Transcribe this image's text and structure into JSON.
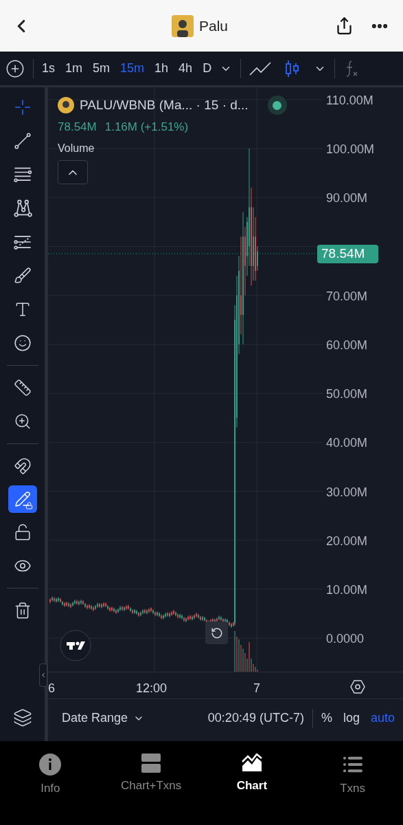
{
  "header": {
    "title": "Palu"
  },
  "toolbar": {
    "timeframes": [
      {
        "label": "1s",
        "selected": false
      },
      {
        "label": "1m",
        "selected": false
      },
      {
        "label": "5m",
        "selected": false
      },
      {
        "label": "15m",
        "selected": true
      },
      {
        "label": "1h",
        "selected": false
      },
      {
        "label": "4h",
        "selected": false
      },
      {
        "label": "D",
        "selected": false
      }
    ],
    "chart_types": [
      {
        "kind": "line",
        "selected": false
      },
      {
        "kind": "candles",
        "selected": true
      }
    ]
  },
  "drawing_tools": [
    {
      "kind": "crosshair",
      "active": true
    },
    {
      "kind": "trendline",
      "active": false
    },
    {
      "kind": "hlines",
      "active": false
    },
    {
      "kind": "pattern",
      "active": false
    },
    {
      "kind": "fib",
      "active": false
    },
    {
      "kind": "brush",
      "active": false
    },
    {
      "kind": "text",
      "active": false
    },
    {
      "kind": "emoji",
      "active": false
    },
    {
      "kind": "divider"
    },
    {
      "kind": "ruler",
      "active": false
    },
    {
      "kind": "zoom",
      "active": false
    },
    {
      "kind": "divider"
    },
    {
      "kind": "magnet",
      "active": false
    },
    {
      "kind": "lockdraw",
      "active": true
    },
    {
      "kind": "unlock",
      "active": false
    },
    {
      "kind": "eye",
      "active": false
    },
    {
      "kind": "divider"
    },
    {
      "kind": "trash",
      "active": false
    }
  ],
  "chart": {
    "symbol": "PALU/WBNB (Ma... · 15 · d...",
    "last": "78.54M",
    "change": "1.16M (+1.51%)",
    "indicator": "Volume",
    "price_tag": "78.54M",
    "price_axis": [
      "110.00M",
      "100.00M",
      "90.00M",
      "70.00M",
      "60.00M",
      "50.00M",
      "40.00M",
      "30.00M",
      "20.00M",
      "10.00M",
      "0.0000"
    ],
    "time_axis": [
      "6",
      "12:00",
      "7"
    ]
  },
  "bottom_bar": {
    "date_range": "Date Range",
    "time": "00:20:49 (UTC-7)",
    "percent": "%",
    "log": "log",
    "auto": "auto"
  },
  "tabs": [
    {
      "label": "Info",
      "kind": "info",
      "selected": false
    },
    {
      "label": "Chart+Txns",
      "kind": "split",
      "selected": false
    },
    {
      "label": "Chart",
      "kind": "chart",
      "selected": true
    },
    {
      "label": "Txns",
      "kind": "list",
      "selected": false
    }
  ]
}
